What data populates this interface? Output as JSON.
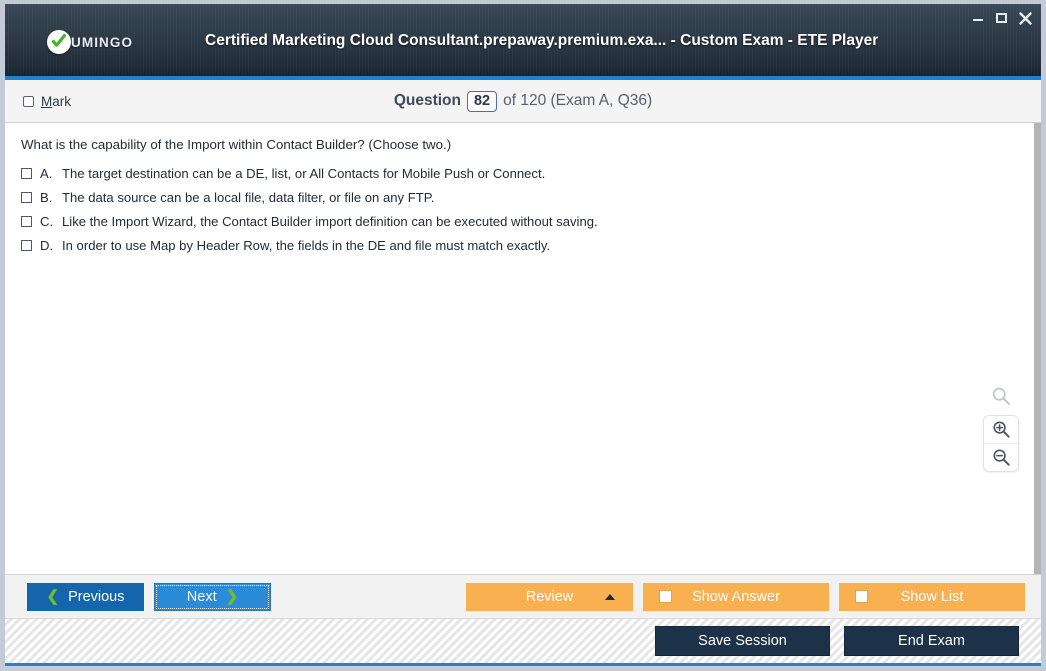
{
  "window": {
    "title": "Certified Marketing Cloud Consultant.prepaway.premium.exa... - Custom Exam - ETE Player",
    "logo_text": "UMINGO",
    "controls": {
      "minimize": "–",
      "maximize": "",
      "close": "✕"
    },
    "accent_color": "#1f7fd0",
    "titlebar_color": "#2b3744"
  },
  "header": {
    "mark_label_prefix": "M",
    "mark_label_rest": "ark",
    "question_word": "Question",
    "question_number": "82",
    "of_text": "of 120 (Exam A, Q36)"
  },
  "question": {
    "text": "What is the capability of the Import within Contact Builder? (Choose two.)",
    "options": [
      {
        "letter": "A.",
        "text": "The target destination can be a DE, list, or All Contacts for Mobile Push or Connect."
      },
      {
        "letter": "B.",
        "text": "The data source can be a local file, data filter, or file on any FTP."
      },
      {
        "letter": "C.",
        "text": "Like the Import Wizard, the Contact Builder import definition can be executed without saving."
      },
      {
        "letter": "D.",
        "text": "In order to use Map by Header Row, the fields in the DE and file must match exactly."
      }
    ]
  },
  "zoom_tools": {
    "magnifier": "magnifier-icon",
    "zoom_in": "zoom-in-icon",
    "zoom_out": "zoom-out-icon"
  },
  "toolbar": {
    "previous_label": "Previous",
    "next_label": "Next",
    "review_label": "Review",
    "show_answer_label": "Show Answer",
    "show_list_label": "Show List",
    "orange_color": "#f9b050",
    "prev_color": "#1565ad",
    "next_color": "#2a8bd8"
  },
  "statusbar": {
    "save_session_label": "Save Session",
    "end_exam_label": "End Exam",
    "navy_color": "#1d3148"
  }
}
